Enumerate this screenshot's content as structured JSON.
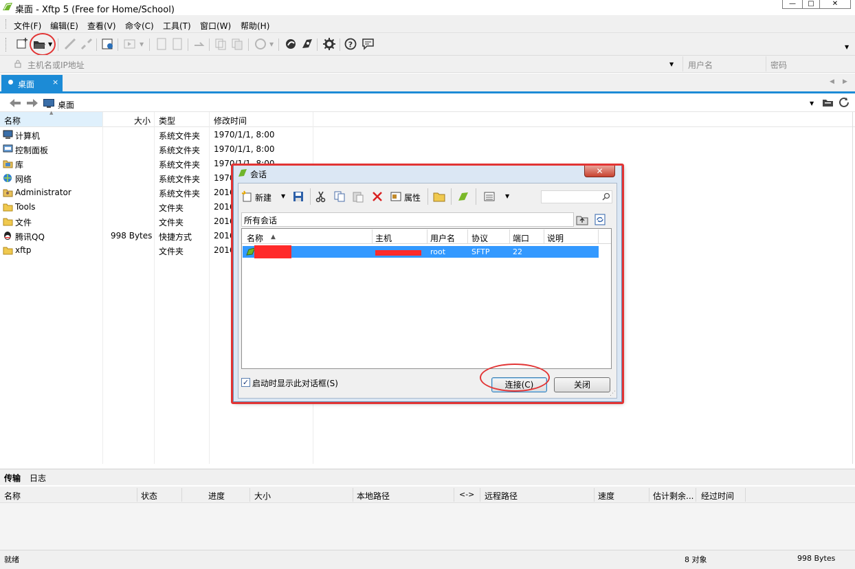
{
  "window": {
    "title": "桌面 - Xftp 5 (Free for Home/School)",
    "min_label": "—",
    "max_label": "□",
    "close_label": "✕"
  },
  "menu": [
    "文件(F)",
    "编辑(E)",
    "查看(V)",
    "命令(C)",
    "工具(T)",
    "窗口(W)",
    "帮助(H)"
  ],
  "address": {
    "host_placeholder": "主机名或IP地址",
    "username_placeholder": "用户名",
    "password_placeholder": "密码"
  },
  "tabs": [
    {
      "label": "桌面",
      "close": "×"
    }
  ],
  "path": {
    "current": "桌面"
  },
  "columns": {
    "name": "名称",
    "size": "大小",
    "type": "类型",
    "modified": "修改时间"
  },
  "files": [
    {
      "name": "计算机",
      "size": "",
      "type": "系统文件夹",
      "modified": "1970/1/1, 8:00",
      "icon": "computer-icon"
    },
    {
      "name": "控制面板",
      "size": "",
      "type": "系统文件夹",
      "modified": "1970/1/1, 8:00",
      "icon": "control-panel-icon"
    },
    {
      "name": "库",
      "size": "",
      "type": "系统文件夹",
      "modified": "1970/1/1, 8:00",
      "icon": "library-icon"
    },
    {
      "name": "网络",
      "size": "",
      "type": "系统文件夹",
      "modified": "1970",
      "icon": "network-icon"
    },
    {
      "name": "Administrator",
      "size": "",
      "type": "系统文件夹",
      "modified": "2016",
      "icon": "user-folder-icon"
    },
    {
      "name": "Tools",
      "size": "",
      "type": "文件夹",
      "modified": "2016",
      "icon": "folder-icon"
    },
    {
      "name": "文件",
      "size": "",
      "type": "文件夹",
      "modified": "2016",
      "icon": "folder-icon"
    },
    {
      "name": "腾讯QQ",
      "size": "998 Bytes",
      "type": "快捷方式",
      "modified": "2016",
      "icon": "qq-icon"
    },
    {
      "name": "xftp",
      "size": "",
      "type": "文件夹",
      "modified": "2016",
      "icon": "folder-icon"
    }
  ],
  "transfer": {
    "tabs": [
      "传输",
      "日志"
    ],
    "columns": [
      "名称",
      "状态",
      "进度",
      "大小",
      "本地路径",
      "<->",
      "远程路径",
      "速度",
      "估计剩余...",
      "经过时间"
    ]
  },
  "status": {
    "left": "就绪",
    "objects": "8 对象",
    "size": "998 Bytes"
  },
  "dialog": {
    "title": "会话",
    "close_label": "✕",
    "toolbar": {
      "new": "新建",
      "properties": "属性"
    },
    "all_sessions": "所有会话",
    "columns": {
      "name": "名称",
      "host": "主机",
      "user": "用户名",
      "protocol": "协议",
      "port": "端口",
      "desc": "说明"
    },
    "sessions": [
      {
        "name": "",
        "host": "",
        "user": "root",
        "protocol": "SFTP",
        "port": "22",
        "desc": ""
      }
    ],
    "startup_checkbox": "启动时显示此对话框(S)",
    "startup_checked": true,
    "connect": "连接(C)",
    "close": "关闭"
  },
  "colors": {
    "accent": "#1c8bd6",
    "selection": "#3399ff",
    "annotation": "#e23434"
  }
}
